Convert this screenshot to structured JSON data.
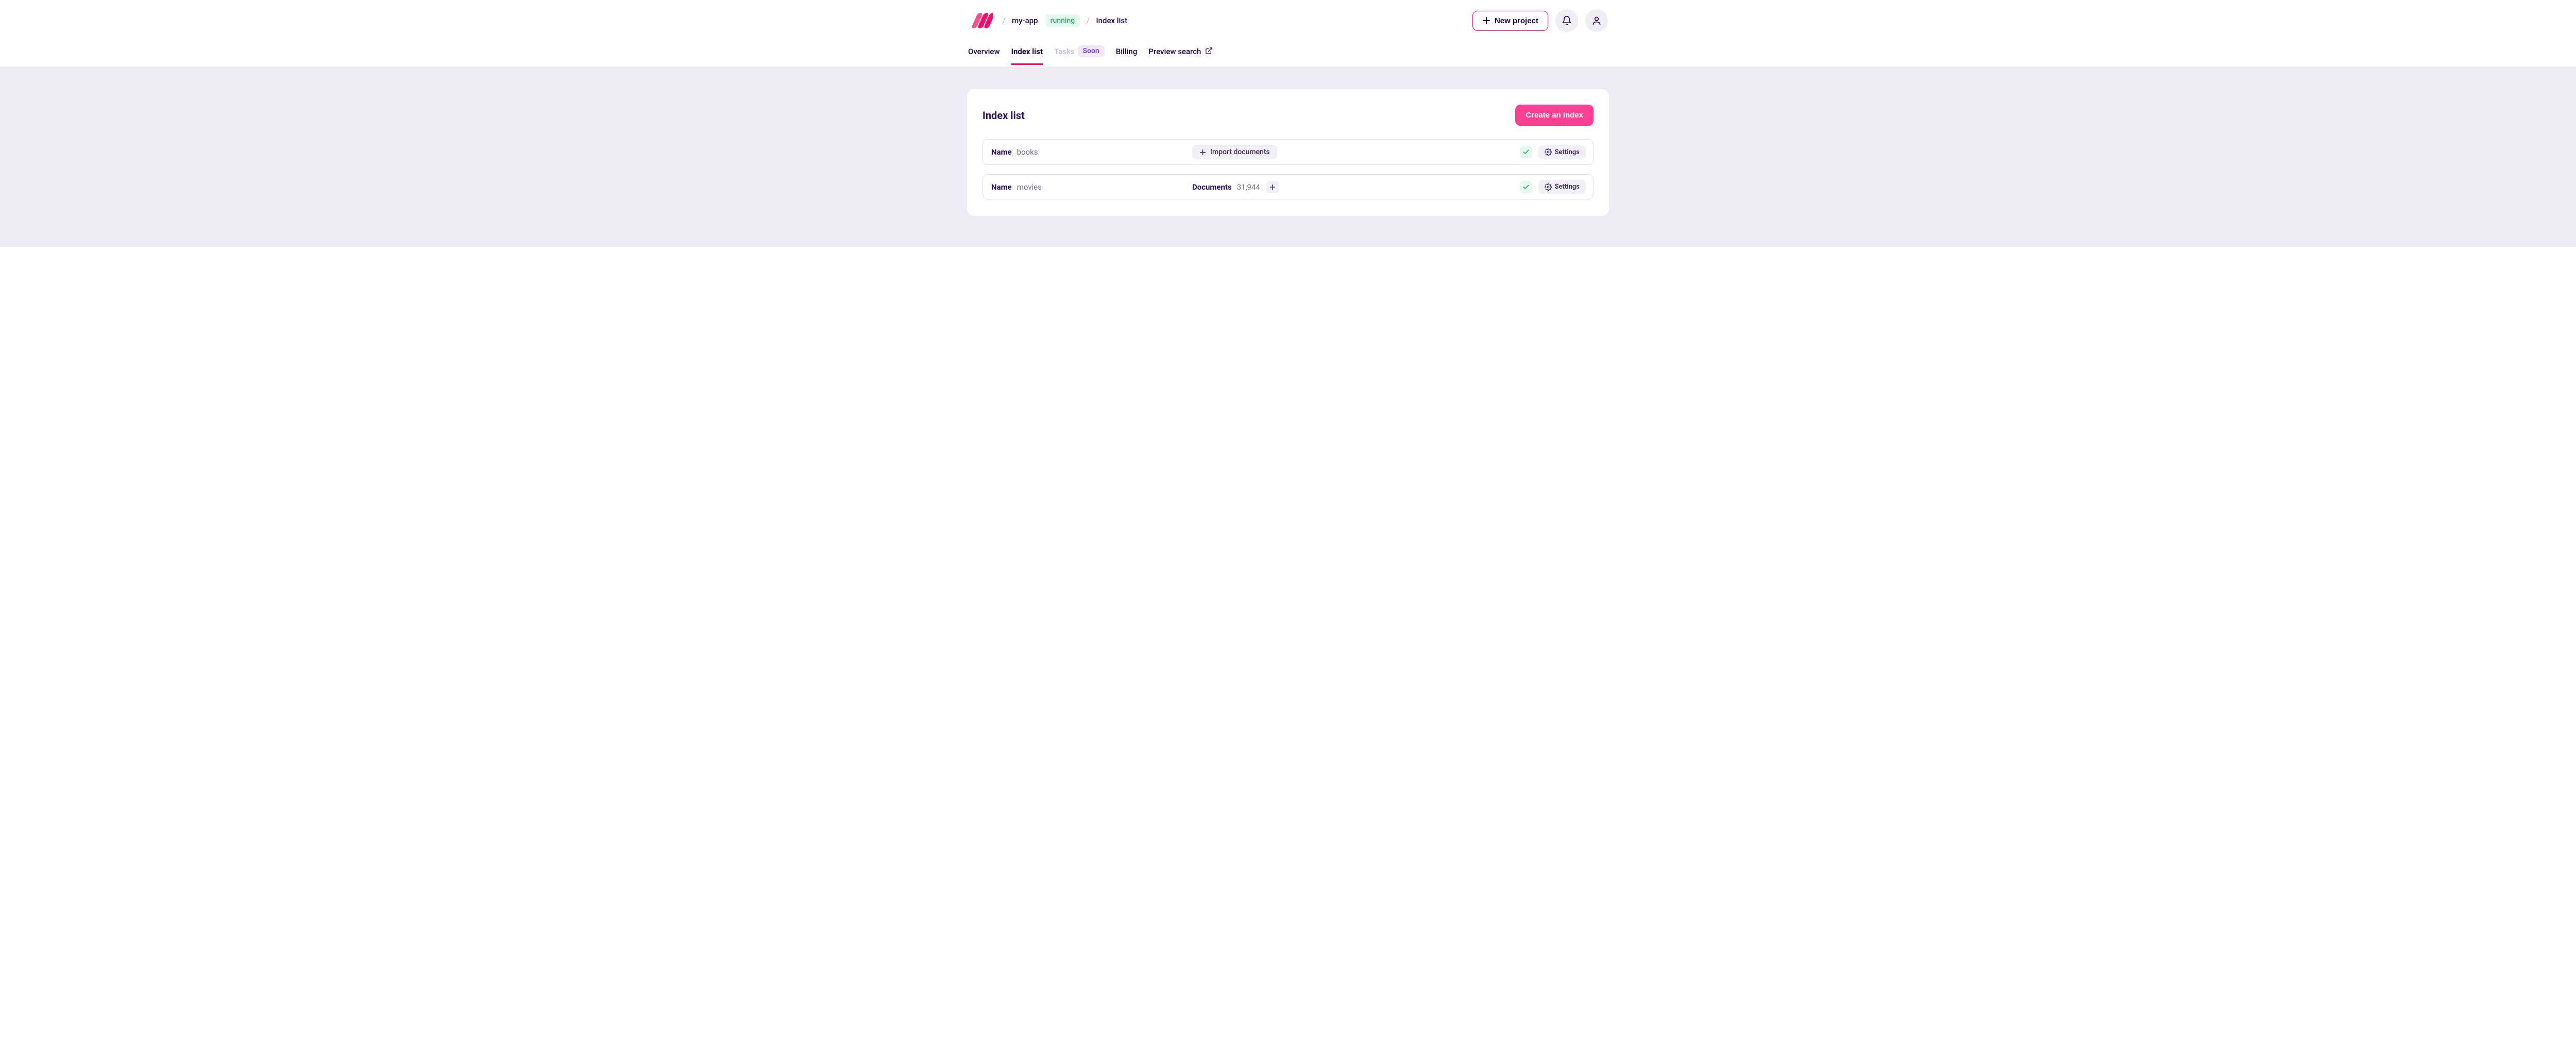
{
  "header": {
    "app_name": "my-app",
    "status": "running",
    "crumb_page": "Index list",
    "new_project_label": "New project"
  },
  "tabs": {
    "overview": "Overview",
    "index_list": "Index list",
    "tasks": "Tasks",
    "soon": "Soon",
    "billing": "Billing",
    "preview_search": "Preview search"
  },
  "card": {
    "title": "Index list",
    "create_button": "Create an index"
  },
  "labels": {
    "name": "Name",
    "documents": "Documents",
    "import_documents": "Import documents",
    "settings": "Settings"
  },
  "indexes": [
    {
      "name": "books",
      "document_count": null
    },
    {
      "name": "movies",
      "document_count": "31,944"
    }
  ],
  "colors": {
    "accent_pink": "#ff0a6c",
    "primary_pink": "#ff4092",
    "status_green_bg": "#e4faee",
    "status_green_fg": "#2fa968",
    "soon_bg": "#f2e6ff",
    "soon_fg": "#7a3de0",
    "text_dark": "#21004b",
    "text_muted": "#756e8b",
    "page_bg": "#edecf4"
  }
}
